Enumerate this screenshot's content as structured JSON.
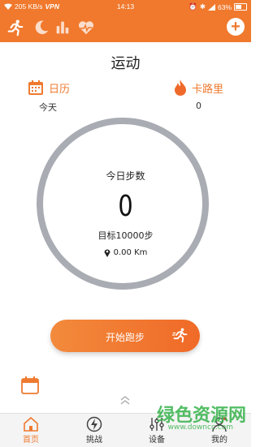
{
  "status_bar": {
    "speed": "205 KB/s",
    "vpn": "VPN",
    "time": "14:13",
    "battery": "63%"
  },
  "header": {
    "tabs": [
      {
        "icon": "running-icon"
      },
      {
        "icon": "moon-icon"
      },
      {
        "icon": "bar-chart-icon"
      },
      {
        "icon": "heart-rate-icon"
      }
    ],
    "add_icon": "plus-icon"
  },
  "page": {
    "title": "运动"
  },
  "stats": {
    "calendar_label": "日历",
    "calendar_value": "今天",
    "calorie_label": "卡路里",
    "calorie_value": "0"
  },
  "ring": {
    "label": "今日步数",
    "steps": "0",
    "goal": "目标10000步",
    "distance": "0.00 Km",
    "progress": 0
  },
  "run_button": {
    "label": "开始跑步"
  },
  "bottom_nav": {
    "items": [
      {
        "label": "首页",
        "icon": "home-icon"
      },
      {
        "label": "挑战",
        "icon": "lightning-icon"
      },
      {
        "label": "设备",
        "icon": "sliders-icon"
      },
      {
        "label": "我的",
        "icon": "user-icon"
      }
    ]
  },
  "watermark": {
    "text": "绿色资源网",
    "sub": "www.downcc.com"
  },
  "colors": {
    "accent": "#f0792d",
    "ring": "#a9acb3",
    "watermark": "#35b24a"
  }
}
